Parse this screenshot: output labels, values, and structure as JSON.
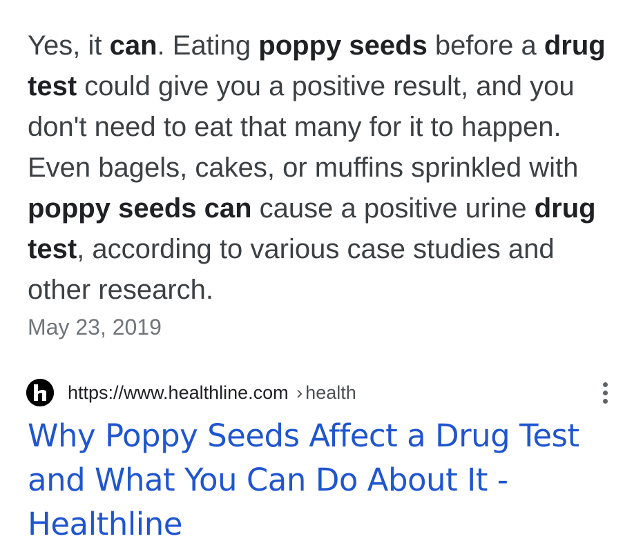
{
  "snippet": {
    "t1": "Yes, it ",
    "b1": "can",
    "t2": ". Eating ",
    "b2": "poppy seeds",
    "t3": " before a ",
    "b3": "drug test",
    "t4": " could give you a positive result, and you don't need to eat that many for it to happen. Even bagels, cakes, or muffins sprinkled with ",
    "b4": "poppy seeds can",
    "t5": " cause a positive urine ",
    "b5": "drug test",
    "t6": ", according to various case studies and other research."
  },
  "date": "May 23, 2019",
  "source": {
    "url": "https://www.healthline.com",
    "separator": "›",
    "breadcrumb": "health",
    "favicon_icon": "healthline-logo-icon",
    "menu_icon": "more-vert-icon"
  },
  "result": {
    "title": "Why Poppy Seeds Affect a Drug Test and What You Can Do About It - Healthline"
  },
  "colors": {
    "link": "#1f55cf",
    "text": "#3c4043",
    "muted": "#70757a"
  }
}
